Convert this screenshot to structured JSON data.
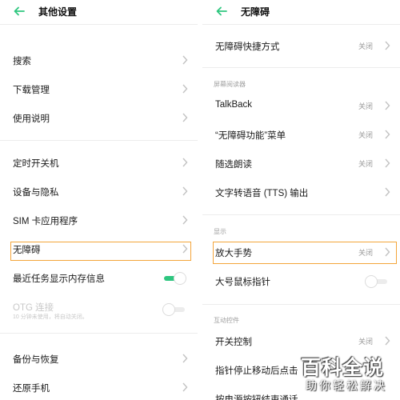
{
  "colors": {
    "accent": "#2ec67f",
    "highlight": "#f4a53a",
    "muted": "#9a9a9a"
  },
  "left": {
    "title": "其他设置",
    "items": [
      {
        "label": "搜索"
      },
      {
        "label": "下载管理"
      },
      {
        "label": "使用说明"
      },
      {
        "label": "定时开关机"
      },
      {
        "label": "设备与隐私"
      },
      {
        "label": "SIM 卡应用程序"
      },
      {
        "label": "无障碍"
      },
      {
        "label": "最近任务显示内存信息",
        "toggle": "on"
      },
      {
        "label": "OTG 连接",
        "sublabel": "10 分钟未使用，将自动关闭。",
        "toggle": "off",
        "disabled": true
      },
      {
        "label": "备份与恢复"
      },
      {
        "label": "还原手机"
      }
    ]
  },
  "right": {
    "title": "无障碍",
    "top_item": {
      "label": "无障碍快捷方式",
      "value": "关闭"
    },
    "sections": {
      "screen_reader": "屏幕阅读器",
      "display": "显示",
      "interaction": "互动控件"
    },
    "items": [
      {
        "label": "TalkBack",
        "value": "关闭"
      },
      {
        "label": "“无障碍功能”菜单",
        "value": "关闭"
      },
      {
        "label": "随选朗读",
        "value": "关闭"
      },
      {
        "label": "文字转语音 (TTS) 输出"
      },
      {
        "label": "放大手势",
        "value": "关闭"
      },
      {
        "label": "大号鼠标指针",
        "toggle": "off"
      },
      {
        "label": "开关控制",
        "value": "关闭"
      },
      {
        "label": "指针停止移动后点击"
      },
      {
        "label": "按电源按钮结束通话"
      }
    ]
  },
  "watermark": {
    "main": "百科全说",
    "sub": "助你轻松解决"
  },
  "icons": {
    "back": "back-arrow-icon",
    "chevron": "chevron-right-icon"
  }
}
